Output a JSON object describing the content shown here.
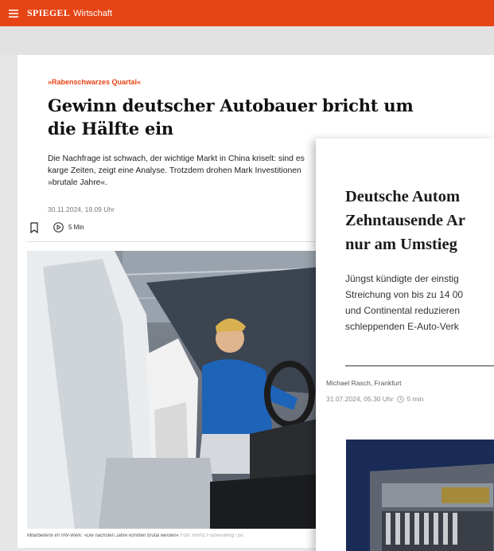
{
  "header": {
    "brand": "SPIEGEL",
    "section": "Wirtschaft",
    "menu_icon": "hamburger-icon"
  },
  "article": {
    "kicker": "»Rabenschwarzes Quartal«",
    "headline": "Gewinn deutscher Autobauer bricht um die Hälfte ein",
    "teaser": "Die Nachfrage ist schwach, der wichtige Markt in China kriselt: sind es karge Zeiten, zeigt eine Analyse. Trotzdem drohen Mark Investitionen »brutale Jahre«.",
    "date": "30.11.2024, 19.09 Uhr",
    "read_time": "5 Min",
    "caption": "Mitarbeiterin im VW-Werk: »Die nächsten Jahre könnten brutal werden«",
    "credit": "Foto: Moritz Frankenberg / pic"
  },
  "overlay": {
    "headline_lines": [
      "Deutsche Autom",
      "Zehntausende Ar",
      "nur am Umstieg"
    ],
    "body_lines": [
      "Jüngst kündigte der einstig",
      "Streichung von bis zu 14 00",
      "und Continental reduzieren",
      "schleppenden E-Auto-Verk"
    ],
    "author": "Michael Rasch, Frankfurt",
    "date": "31.07.2024, 05.30 Uhr",
    "read_time": "5 min"
  }
}
